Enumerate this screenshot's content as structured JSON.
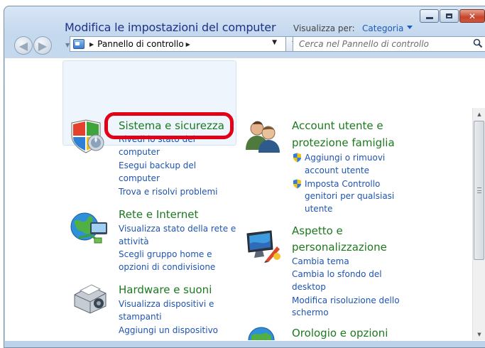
{
  "address": {
    "crumb": "Pannello di controllo"
  },
  "search": {
    "placeholder": "Cerca nel Pannello di controllo"
  },
  "header": {
    "title": "Modifica le impostazioni del computer",
    "view_label": "Visualizza per:",
    "view_value": "Categoria"
  },
  "categories": {
    "sistema": {
      "title": "Sistema e sicurezza",
      "links": [
        "Rivedi lo stato del",
        "computer",
        "Esegui backup del",
        "computer",
        "Trova e risolvi problemi"
      ]
    },
    "rete": {
      "title": "Rete e Internet",
      "links": [
        "Visualizza stato della rete e",
        "attività",
        "Scegli gruppo home e",
        "opzioni di condivisione"
      ]
    },
    "hardware": {
      "title": "Hardware e suoni",
      "links": [
        "Visualizza dispositivi e",
        "stampanti",
        "Aggiungi un dispositivo"
      ]
    },
    "account": {
      "title_line1": "Account utente e",
      "title_line2": "protezione famiglia",
      "links": [
        "Aggiungi o rimuovi",
        "account utente",
        "Imposta Controllo",
        "genitori per qualsiasi",
        "utente"
      ]
    },
    "aspetto": {
      "title_line1": "Aspetto e",
      "title_line2": "personalizzazione",
      "links": [
        "Cambia tema",
        "Cambia lo sfondo del",
        "desktop",
        "Modifica risoluzione dello",
        "schermo"
      ]
    },
    "orologio": {
      "title": "Orologio e opzioni"
    }
  },
  "icons": {
    "back": "back-arrow-icon",
    "forward": "forward-arrow-icon",
    "refresh": "refresh-icon",
    "search": "search-icon"
  },
  "colors": {
    "category_title": "#1c7a1e",
    "link": "#1f54b0",
    "page_title": "#1e3287",
    "highlight_ring": "#e30016"
  }
}
